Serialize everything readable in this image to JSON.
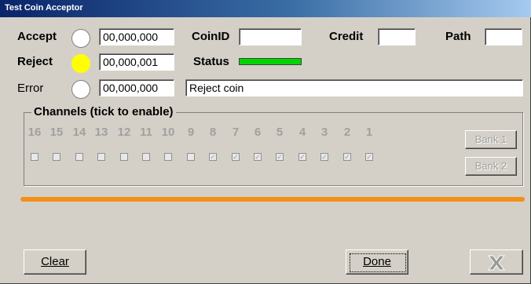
{
  "window": {
    "title": "Test Coin Acceptor"
  },
  "counters": {
    "accept_label": "Accept",
    "accept_value": "00,000,000",
    "reject_label": "Reject",
    "reject_value": "00,000,001",
    "error_label": "Error",
    "error_value": "00,000,000"
  },
  "fields": {
    "coinid_label": "CoinID",
    "coinid_value": "",
    "credit_label": "Credit",
    "credit_value": "",
    "path_label": "Path",
    "path_value": "",
    "status_label": "Status",
    "status_color": "#00d400",
    "message": "Reject coin"
  },
  "lamps": {
    "accept_on": false,
    "reject_on": true,
    "error_on": false,
    "on_color": "#ffff00"
  },
  "channels": {
    "title": "Channels (tick to enable)",
    "numbers": [
      "16",
      "15",
      "14",
      "13",
      "12",
      "11",
      "10",
      "9",
      "8",
      "7",
      "6",
      "5",
      "4",
      "3",
      "2",
      "1"
    ],
    "checked": [
      false,
      false,
      false,
      false,
      false,
      false,
      false,
      false,
      true,
      true,
      true,
      true,
      true,
      true,
      true,
      true
    ]
  },
  "buttons": {
    "bank1": "Bank 1",
    "bank2": "Bank 2",
    "clear": "Clear",
    "done": "Done",
    "cancel_icon": "x-icon"
  },
  "progress": {
    "fraction": 1.0,
    "color": "#f39019"
  }
}
